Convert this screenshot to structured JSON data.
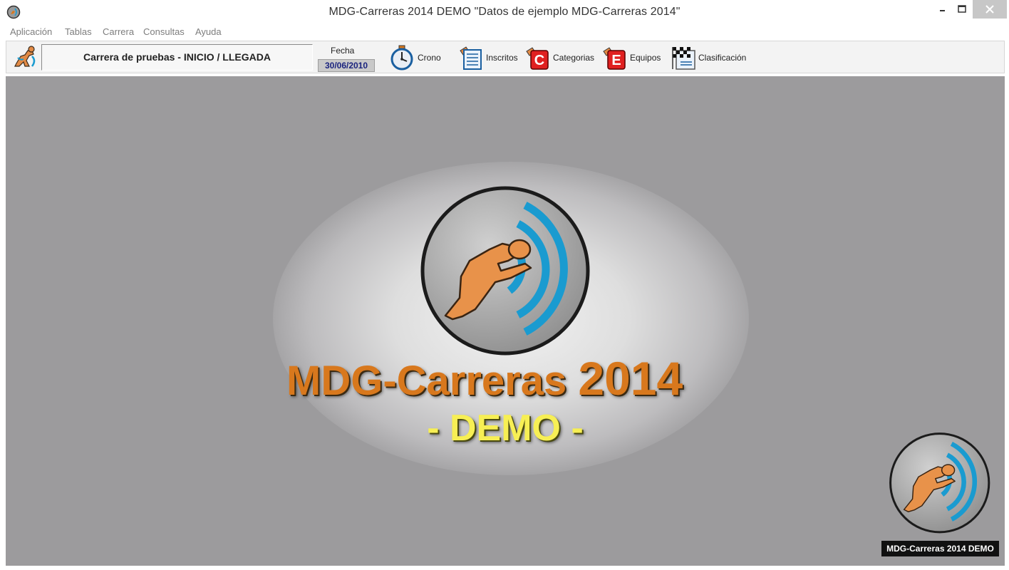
{
  "window": {
    "title": "MDG-Carreras 2014 DEMO \"Datos de ejemplo MDG-Carreras 2014\"",
    "app_icon": "app-logo-icon"
  },
  "menu": {
    "items": [
      "Aplicación",
      "Tablas",
      "Carrera",
      "Consultas",
      "Ayuda"
    ]
  },
  "toolbar": {
    "race_name": "Carrera de pruebas - INICIO / LLEGADA",
    "fecha_label": "Fecha",
    "fecha_value": "30/06/2010",
    "tools": [
      {
        "label": "Crono",
        "icon": "stopwatch-icon"
      },
      {
        "label": "Inscritos",
        "icon": "registrants-list-icon"
      },
      {
        "label": "Categorias",
        "icon": "categories-icon"
      },
      {
        "label": "Equipos",
        "icon": "teams-icon"
      },
      {
        "label": "Clasificación",
        "icon": "checkered-flag-icon"
      }
    ]
  },
  "splash": {
    "brand_name": "MDG-Carreras",
    "brand_year": "2014",
    "edition": "- DEMO -",
    "badge": "MDG-Carreras 2014 DEMO"
  },
  "colors": {
    "workspace": "#9c9b9d",
    "brand_orange": "#d8781d",
    "demo_yellow": "#f7ef54",
    "signal_blue": "#1a9bd0"
  }
}
